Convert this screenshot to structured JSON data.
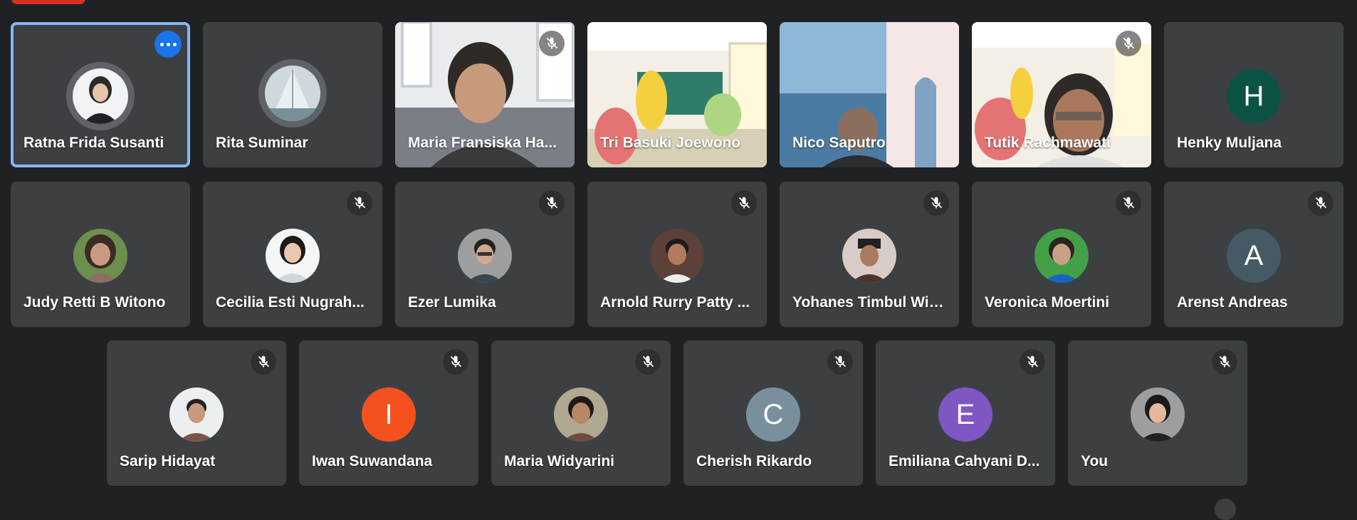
{
  "app": "Google Meet",
  "participants": [
    {
      "name": "Ratna Frida Susanti",
      "type": "photo",
      "active": true,
      "muted": false,
      "more_menu": true
    },
    {
      "name": "Rita Suminar",
      "type": "photo",
      "muted": false
    },
    {
      "name": "Maria Fransiska Ha...",
      "type": "video",
      "muted": true
    },
    {
      "name": "Tri Basuki Joewono",
      "type": "video",
      "muted": false
    },
    {
      "name": "Nico Saputro",
      "type": "video",
      "muted": false
    },
    {
      "name": "Tutik Rachmawati",
      "type": "video",
      "muted": true
    },
    {
      "name": "Henky Muljana",
      "type": "letter",
      "letter": "H",
      "color": "#0b5345",
      "muted": false
    },
    {
      "name": "Judy Retti B Witono",
      "type": "photo",
      "muted": false
    },
    {
      "name": "Cecilia Esti Nugrah...",
      "type": "photo",
      "muted": true
    },
    {
      "name": "Ezer Lumika",
      "type": "photo",
      "muted": true
    },
    {
      "name": "Arnold Rurry Patty ...",
      "type": "photo",
      "muted": true
    },
    {
      "name": "Yohanes Timbul Wid...",
      "type": "photo",
      "muted": true
    },
    {
      "name": "Veronica Moertini",
      "type": "photo",
      "muted": true
    },
    {
      "name": "Arenst Andreas",
      "type": "letter",
      "letter": "A",
      "color": "#455a64",
      "muted": true
    },
    {
      "name": "Sarip Hidayat",
      "type": "photo",
      "muted": true
    },
    {
      "name": "Iwan Suwandana",
      "type": "letter",
      "letter": "I",
      "color": "#f4511e",
      "muted": true
    },
    {
      "name": "Maria Widyarini",
      "type": "photo",
      "muted": true
    },
    {
      "name": "Cherish Rikardo",
      "type": "letter",
      "letter": "C",
      "color": "#78909c",
      "muted": true
    },
    {
      "name": "Emiliana Cahyani D...",
      "type": "letter",
      "letter": "E",
      "color": "#7e57c2",
      "muted": true
    },
    {
      "name": "You",
      "type": "photo",
      "muted": true
    }
  ],
  "colors": {
    "background": "#202124",
    "tile": "#3c4043",
    "active_border": "#8ab4f8",
    "accent": "#1a73e8"
  },
  "icons": {
    "mute": "mic-off-icon",
    "more": "more-horiz-icon"
  }
}
